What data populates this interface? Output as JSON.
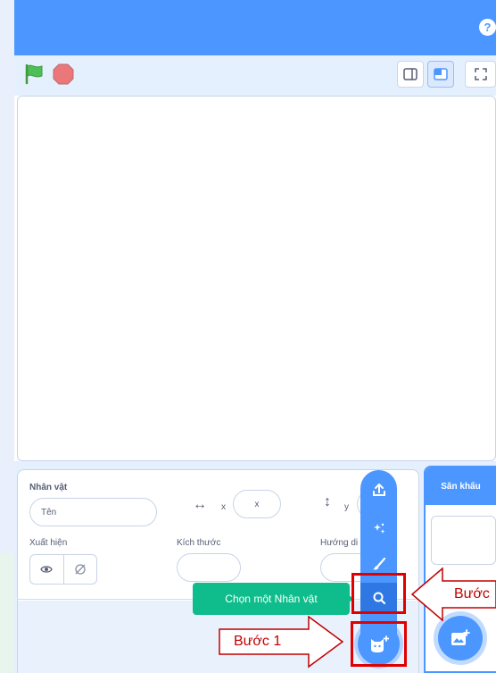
{
  "topbar": {
    "help_label": "?"
  },
  "stage_header": {
    "green_flag_icon": "green-flag",
    "stop_icon": "stop-sign",
    "view_modes": [
      "small-stage",
      "normal-stage",
      "fullscreen"
    ]
  },
  "sprite_info": {
    "title": "Nhân vật",
    "name_placeholder": "Tên",
    "x_axis_label": "x",
    "x_value": "x",
    "y_axis_label": "y",
    "show_label": "Xuất hiện",
    "size_label": "Kích thước",
    "direction_label": "Hướng di"
  },
  "stage_panel": {
    "title": "Sân khấu"
  },
  "sprite_menu": {
    "items": [
      "upload-icon",
      "surprise-icon",
      "paint-icon",
      "search-icon"
    ],
    "tooltip": "Chọn một Nhân vật"
  },
  "annotations": {
    "step1": "Bước 1",
    "step2_partial": "Bước"
  },
  "colors": {
    "primary_blue": "#4c97ff",
    "green": "#0fbd8c",
    "highlight_red": "#e00000",
    "panel_bg": "#e5f0ff"
  }
}
